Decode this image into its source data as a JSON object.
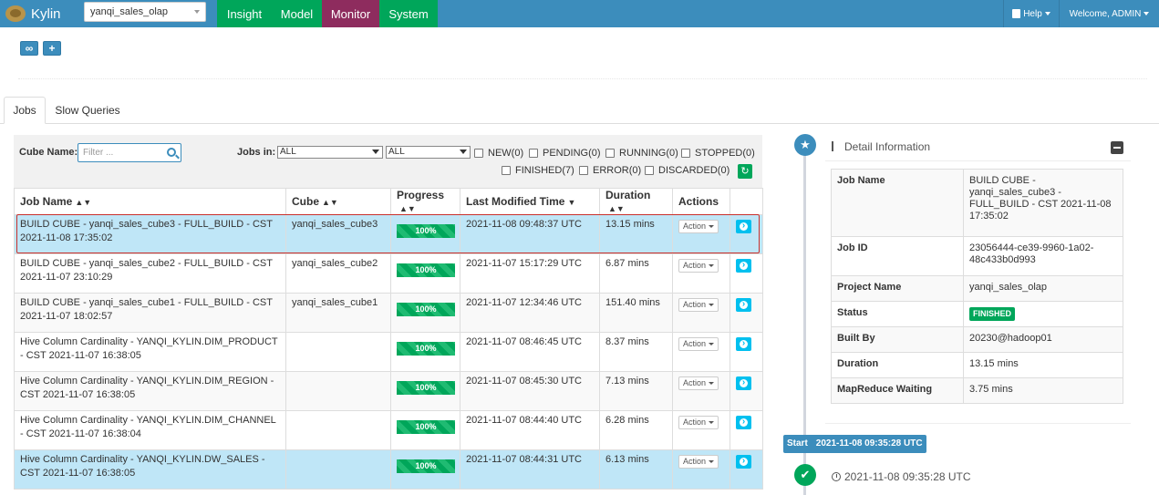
{
  "app": {
    "brand": "Kylin",
    "project": "yanqi_sales_olap"
  },
  "nav": {
    "insight": "Insight",
    "model": "Model",
    "monitor": "Monitor",
    "system": "System",
    "help": "Help",
    "welcome": "Welcome, ADMIN"
  },
  "toolbar": {
    "icon1": "users-icon",
    "icon2": "plus-icon"
  },
  "tabs": {
    "jobs": "Jobs",
    "slow": "Slow Queries"
  },
  "filters": {
    "cube_label": "Cube Name:",
    "cube_placeholder": "Filter ...",
    "jobs_in_label": "Jobs in:",
    "select1": "ALL",
    "select2": "ALL",
    "statuses": [
      "NEW(0)",
      "PENDING(0)",
      "RUNNING(0)",
      "STOPPED(0)",
      "FINISHED(7)",
      "ERROR(0)",
      "DISCARDED(0)"
    ]
  },
  "table": {
    "headers": {
      "job_name": "Job Name",
      "cube": "Cube",
      "progress": "Progress",
      "modified": "Last Modified Time",
      "duration": "Duration",
      "actions": "Actions"
    },
    "action_label": "Action",
    "rows": [
      {
        "name": "BUILD CUBE - yanqi_sales_cube3 - FULL_BUILD - CST 2021-11-08 17:35:02",
        "cube": "yanqi_sales_cube3",
        "progress": "100%",
        "modified": "2021-11-08 09:48:37 UTC",
        "duration": "13.15 mins"
      },
      {
        "name": "BUILD CUBE - yanqi_sales_cube2 - FULL_BUILD - CST 2021-11-07 23:10:29",
        "cube": "yanqi_sales_cube2",
        "progress": "100%",
        "modified": "2021-11-07 15:17:29 UTC",
        "duration": "6.87 mins"
      },
      {
        "name": "BUILD CUBE - yanqi_sales_cube1 - FULL_BUILD - CST 2021-11-07 18:02:57",
        "cube": "yanqi_sales_cube1",
        "progress": "100%",
        "modified": "2021-11-07 12:34:46 UTC",
        "duration": "151.40 mins"
      },
      {
        "name": "Hive Column Cardinality - YANQI_KYLIN.DIM_PRODUCT - CST 2021-11-07 16:38:05",
        "cube": "",
        "progress": "100%",
        "modified": "2021-11-07 08:46:45 UTC",
        "duration": "8.37 mins"
      },
      {
        "name": "Hive Column Cardinality - YANQI_KYLIN.DIM_REGION - CST 2021-11-07 16:38:05",
        "cube": "",
        "progress": "100%",
        "modified": "2021-11-07 08:45:30 UTC",
        "duration": "7.13 mins"
      },
      {
        "name": "Hive Column Cardinality - YANQI_KYLIN.DIM_CHANNEL - CST 2021-11-07 16:38:04",
        "cube": "",
        "progress": "100%",
        "modified": "2021-11-07 08:44:40 UTC",
        "duration": "6.28 mins"
      },
      {
        "name": "Hive Column Cardinality - YANQI_KYLIN.DW_SALES - CST 2021-11-07 16:38:05",
        "cube": "",
        "progress": "100%",
        "modified": "2021-11-07 08:44:31 UTC",
        "duration": "6.13 mins"
      }
    ]
  },
  "detail": {
    "title": "Detail Information",
    "fields": [
      {
        "key": "Job Name",
        "value": "BUILD CUBE - yanqi_sales_cube3 - FULL_BUILD - CST 2021-11-08 17:35:02"
      },
      {
        "key": "Job ID",
        "value": "23056444-ce39-9960-1a02-48c433b0d993"
      },
      {
        "key": "Project Name",
        "value": "yanqi_sales_olap"
      },
      {
        "key": "Status",
        "value": "FINISHED"
      },
      {
        "key": "Built By",
        "value": "20230@hadoop01"
      },
      {
        "key": "Duration",
        "value": "13.15 mins"
      },
      {
        "key": "MapReduce Waiting",
        "value": "3.75 mins"
      }
    ],
    "start_label": "Start",
    "start_time": "2021-11-08 09:35:28 UTC",
    "step_time": "2021-11-08 09:35:28 UTC"
  },
  "colors": {
    "navbar": "#3c8dbc",
    "nav_green": "#00a65a",
    "nav_active": "#8e2c5e",
    "selected_row": "#bfe6f7",
    "finished": "#00a65a"
  }
}
